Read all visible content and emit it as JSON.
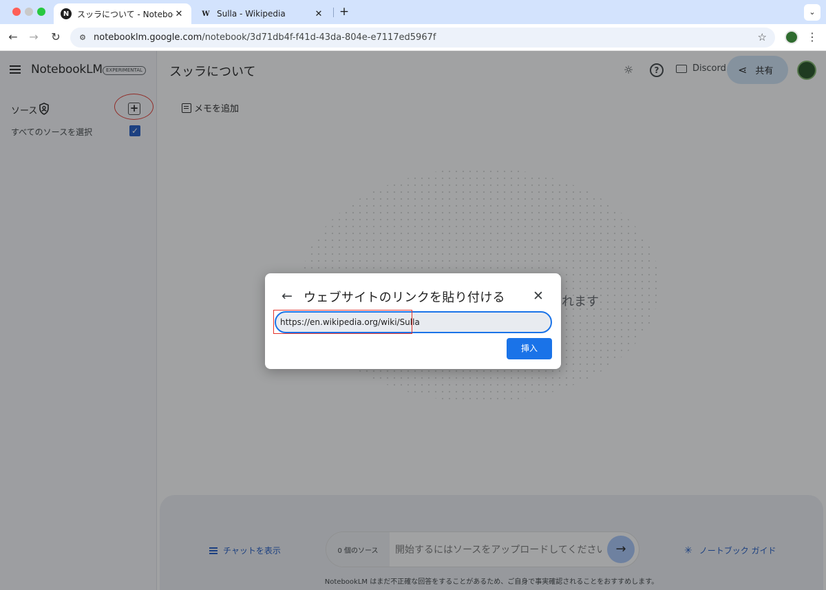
{
  "browser": {
    "tabs": [
      {
        "favicon": "N",
        "title": "スッラについて - NotebookLM",
        "close": "✕"
      },
      {
        "favicon": "W",
        "title": "Sulla - Wikipedia",
        "close": "✕"
      }
    ],
    "new_tab": "+",
    "url_host": "notebooklm.google.com",
    "url_path": "/notebook/3d71db4f-f41d-43da-804e-e7117ed5967f"
  },
  "sidebar": {
    "brand": "NotebookLM",
    "badge": "EXPERIMENTAL",
    "sources_label": "ソース",
    "add_source": "+",
    "select_all_label": "すべてのソースを選択",
    "select_all_checked": true
  },
  "header": {
    "title": "スッラについて",
    "discord": "Discord",
    "share": "共有"
  },
  "main": {
    "add_note": "メモを追加",
    "empty_partial": "れます"
  },
  "chat": {
    "show_chat": "チャットを表示",
    "source_count": "0 個のソース",
    "placeholder": "開始するにはソースをアップロードしてください",
    "notebook_guide": "ノートブック ガイド",
    "disclaimer": "NotebookLM はまだ不正確な回答をすることがあるため、ご自身で事実確認されることをおすすめします。"
  },
  "modal": {
    "title": "ウェブサイトのリンクを貼り付ける",
    "url_value": "https://en.wikipedia.org/wiki/Sulla",
    "insert": "挿入"
  },
  "colors": {
    "accent": "#1a73e8",
    "highlight": "#e5342c",
    "tabstrip": "#d3e3fd"
  },
  "icons": [
    "back-arrow-icon",
    "forward-arrow-icon",
    "reload-icon",
    "site-info-icon",
    "bookmark-star-icon",
    "menu-icon",
    "shield-icon",
    "add-icon",
    "check-icon",
    "theme-icon",
    "help-icon",
    "discord-icon",
    "share-icon",
    "note-icon",
    "chat-icon",
    "send-icon",
    "guide-icon",
    "close-icon"
  ]
}
